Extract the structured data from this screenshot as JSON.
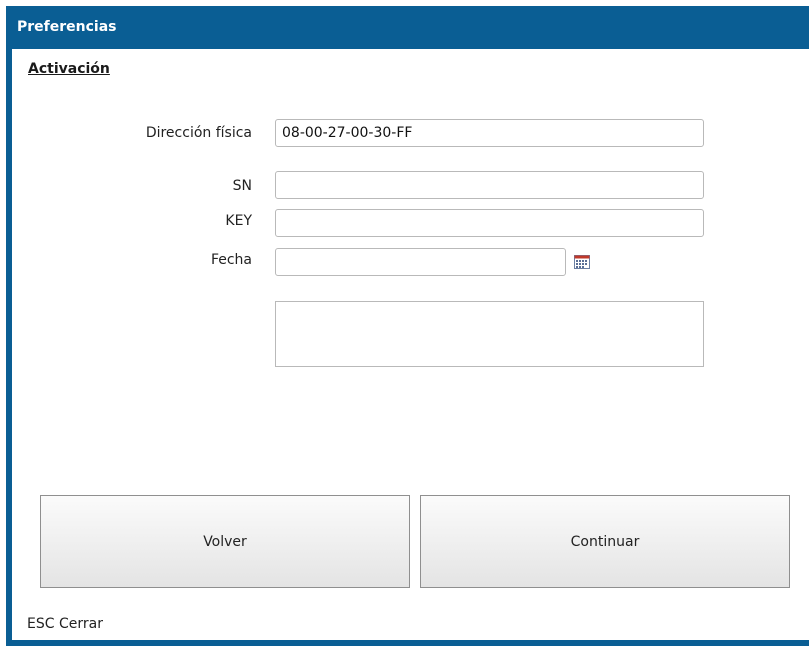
{
  "window": {
    "title": "Preferencias"
  },
  "section": {
    "title": "Activación"
  },
  "form": {
    "mac_label": "Dirección física",
    "mac_value": "08-00-27-00-30-FF",
    "sn_label": "SN",
    "sn_value": "",
    "key_label": "KEY",
    "key_value": "",
    "date_label": "Fecha",
    "date_value": "",
    "message_value": ""
  },
  "buttons": {
    "back_label": "Volver",
    "continue_label": "Continuar"
  },
  "footer": {
    "hint": "ESC Cerrar"
  },
  "icons": {
    "date_picker": "calendar-icon"
  },
  "colors": {
    "frame": "#0a5e94",
    "title_text": "#ffffff"
  }
}
